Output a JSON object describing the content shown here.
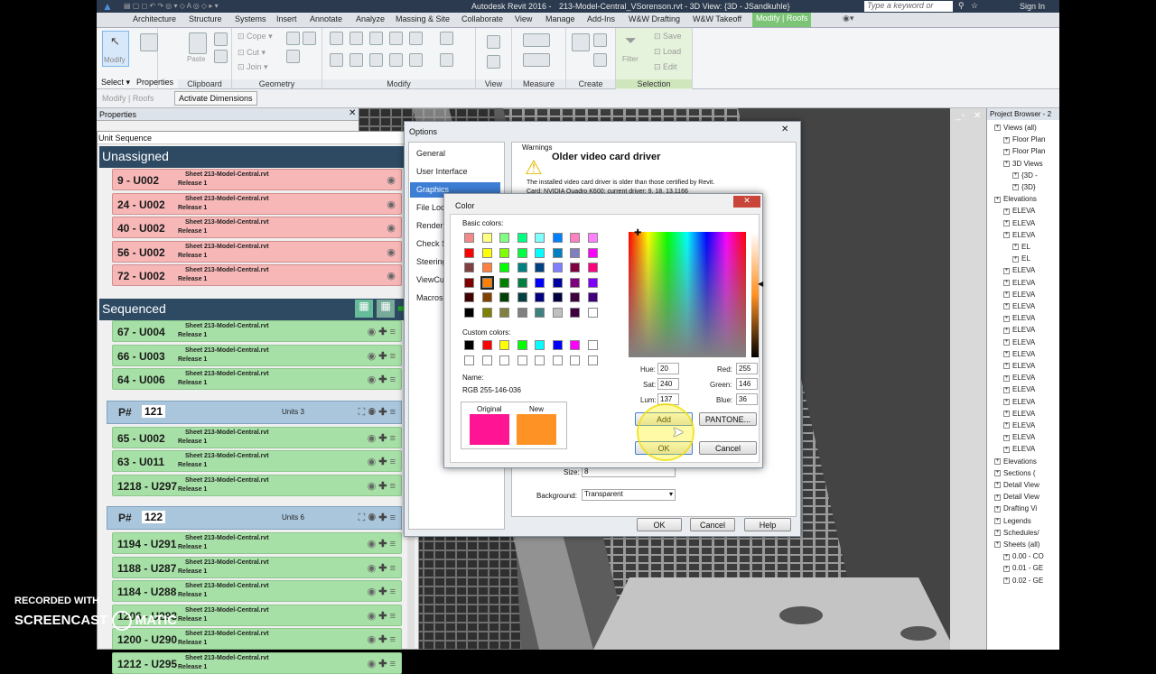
{
  "title_bar": {
    "app": "Autodesk Revit 2016 -",
    "doc": "213-Model-Central_VSorenson.rvt - 3D View: {3D - JSandkuhle}",
    "search_placeholder": "Type a keyword or phrase",
    "signin": "Sign In"
  },
  "menu_tabs": [
    "Architecture",
    "Structure",
    "Systems",
    "Insert",
    "Annotate",
    "Analyze",
    "Massing & Site",
    "Collaborate",
    "View",
    "Manage",
    "Add-Ins",
    "W&W Drafting",
    "W&W Takeoff",
    "Modify | Roofs"
  ],
  "ribbon": {
    "modify_label": "Modify",
    "select_label": "Select ▾",
    "paste_label": "Paste",
    "properties_label": "Properties",
    "clipboard_label": "Clipboard",
    "geometry_items": [
      "Cope ▾",
      "Cut ▾",
      "Join ▾"
    ],
    "geometry_label": "Geometry",
    "modify_group_label": "Modify",
    "view_label": "View",
    "measure_label": "Measure",
    "create_label": "Create",
    "filter_label": "Filter",
    "save_label": "Save",
    "load_label": "Load",
    "edit_label": "Edit",
    "selection_label": "Selection"
  },
  "option_bar": {
    "context": "Modify | Roofs",
    "activate": "Activate Dimensions"
  },
  "properties": {
    "title": "Properties"
  },
  "unit_sequence": {
    "title": "Unit Sequence",
    "unassigned_header": "Unassigned",
    "sequenced_header": "Sequenced",
    "unassigned": [
      {
        "name": "9 - U002",
        "sheet": "Sheet 213-Model-Central.rvt",
        "release": "Release 1"
      },
      {
        "name": "24 - U002",
        "sheet": "Sheet 213-Model-Central.rvt",
        "release": "Release 1"
      },
      {
        "name": "40 - U002",
        "sheet": "Sheet 213-Model-Central.rvt",
        "release": "Release 1"
      },
      {
        "name": "56 - U002",
        "sheet": "Sheet 213-Model-Central.rvt",
        "release": "Release 1"
      },
      {
        "name": "72 - U002",
        "sheet": "Sheet 213-Model-Central.rvt",
        "release": "Release 1"
      }
    ],
    "seq_top": [
      {
        "name": "67 - U004",
        "sheet": "Sheet 213-Model-Central.rvt",
        "release": "Release 1"
      },
      {
        "name": "66 - U003",
        "sheet": "Sheet 213-Model-Central.rvt",
        "release": "Release 1"
      },
      {
        "name": "64 - U006",
        "sheet": "Sheet 213-Model-Central.rvt",
        "release": "Release 1"
      }
    ],
    "group1": {
      "label": "P#",
      "number": "121",
      "units": "Units 3"
    },
    "group1_items": [
      {
        "name": "65 - U002",
        "sheet": "Sheet 213-Model-Central.rvt",
        "release": "Release 1"
      },
      {
        "name": "63 - U011",
        "sheet": "Sheet 213-Model-Central.rvt",
        "release": "Release 1"
      },
      {
        "name": "1218 - U297",
        "sheet": "Sheet 213-Model-Central.rvt",
        "release": "Release 1"
      }
    ],
    "group2": {
      "label": "P#",
      "number": "122",
      "units": "Units 6"
    },
    "group2_items": [
      {
        "name": "1194 - U291",
        "sheet": "Sheet 213-Model-Central.rvt",
        "release": "Release 1"
      },
      {
        "name": "1188 - U287",
        "sheet": "Sheet 213-Model-Central.rvt",
        "release": "Release 1"
      },
      {
        "name": "1184 - U288",
        "sheet": "Sheet 213-Model-Central.rvt",
        "release": "Release 1"
      },
      {
        "name": "1206 - U293",
        "sheet": "Sheet 213-Model-Central.rvt",
        "release": "Release 1"
      },
      {
        "name": "1200 - U290",
        "sheet": "Sheet 213-Model-Central.rvt",
        "release": "Release 1"
      },
      {
        "name": "1212 - U295",
        "sheet": "Sheet 213-Model-Central.rvt",
        "release": "Release 1"
      }
    ]
  },
  "options_dialog": {
    "title": "Options",
    "nav": [
      "General",
      "User Interface",
      "Graphics",
      "File Locations",
      "Rendering",
      "Check Spelling",
      "SteeringWheels",
      "ViewCube",
      "Macros"
    ],
    "warnings_label": "Warnings",
    "warning_title": "Older video card driver",
    "warning_text": "The installed video card driver is older than those certified by Revit.",
    "card_text": "Card: NVIDIA Quadro K600; current driver: 9. 18. 13.1166",
    "size_label": "Size:",
    "size_value": "8",
    "background_label": "Background:",
    "background_value": "Transparent",
    "ok": "OK",
    "cancel": "Cancel",
    "help": "Help"
  },
  "color_dialog": {
    "title": "Color",
    "basic_label": "Basic colors:",
    "custom_label": "Custom colors:",
    "name_label": "Name:",
    "name_value": "RGB 255-146-036",
    "original_label": "Original",
    "new_label": "New",
    "original_color": "#ff1493",
    "new_color": "#ff9224",
    "hue_label": "Hue:",
    "hue": "20",
    "sat_label": "Sat:",
    "sat": "240",
    "lum_label": "Lum:",
    "lum": "137",
    "red_label": "Red:",
    "red": "255",
    "green_label": "Green:",
    "green": "146",
    "blue_label": "Blue:",
    "blue": "36",
    "add": "Add",
    "pantone": "PANTONE...",
    "ok": "OK",
    "cancel": "Cancel",
    "basic_colors": [
      "#f28a8a",
      "#ffff80",
      "#80ff80",
      "#00ff80",
      "#80ffff",
      "#0080ff",
      "#ff80c0",
      "#ff80ff",
      "#ff0000",
      "#ffff00",
      "#80ff00",
      "#00ff40",
      "#00ffff",
      "#0080c0",
      "#8080c0",
      "#ff00ff",
      "#804040",
      "#ff8040",
      "#00ff00",
      "#008080",
      "#004080",
      "#8080ff",
      "#800040",
      "#ff0080",
      "#800000",
      "#ff8000",
      "#008000",
      "#008040",
      "#0000ff",
      "#0000a0",
      "#800080",
      "#8000ff",
      "#400000",
      "#804000",
      "#004000",
      "#004040",
      "#000080",
      "#000040",
      "#400040",
      "#400080",
      "#000000",
      "#808000",
      "#808040",
      "#808080",
      "#408080",
      "#c0c0c0",
      "#400040",
      "#ffffff"
    ],
    "custom_colors": [
      "#000000",
      "#ff0000",
      "#ffff00",
      "#00ff00",
      "#00ffff",
      "#0000ff",
      "#ff00ff",
      "#ffffff",
      "#ffffff",
      "#ffffff",
      "#ffffff",
      "#ffffff",
      "#ffffff",
      "#ffffff",
      "#ffffff",
      "#ffffff"
    ]
  },
  "project_browser": {
    "title": "Project Browser - 2",
    "items": [
      "Views (all)",
      "Floor Plan",
      "Floor Plan",
      "3D Views",
      "{3D -",
      "{3D}",
      "Elevations",
      "ELEVA",
      "ELEVA",
      "ELEVA",
      "EL",
      "EL",
      "ELEVA",
      "ELEVA",
      "ELEVA",
      "ELEVA",
      "ELEVA",
      "ELEVA",
      "ELEVA",
      "ELEVA",
      "ELEVA",
      "ELEVA",
      "ELEVA",
      "ELEVA",
      "ELEVA",
      "ELEVA",
      "ELEVA",
      "ELEVA",
      "Elevations",
      "Sections (",
      "Detail View",
      "Detail View",
      "Drafting Vi",
      "Legends",
      "Schedules/",
      "Sheets (all)",
      "0.00 - CO",
      "0.01 - GE",
      "0.02 - GE"
    ]
  },
  "watermark": {
    "line1": "RECORDED WITH",
    "line2": "SCREENCAST",
    "line3": "MATIC"
  }
}
